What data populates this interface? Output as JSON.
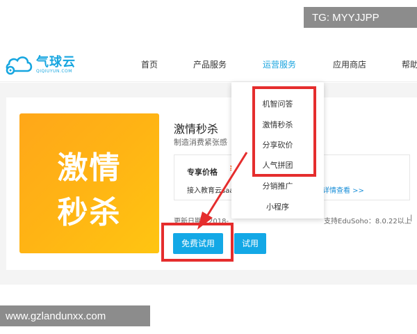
{
  "watermarks": {
    "top": "TG: MYYJJPP",
    "bottom": "www.gzlandunxx.com"
  },
  "brand": {
    "name": "气球云",
    "sub": "QIQIUYUN.COM",
    "color": "#17a6e0"
  },
  "nav": {
    "items": [
      {
        "label": "首页"
      },
      {
        "label": "产品服务"
      },
      {
        "label": "运营服务"
      },
      {
        "label": "应用商店"
      },
      {
        "label": "帮助"
      }
    ],
    "active": "运营服务"
  },
  "dropdown": {
    "items": [
      {
        "label": "机智问答"
      },
      {
        "label": "激情秒杀"
      },
      {
        "label": "分享砍价"
      },
      {
        "label": "人气拼团"
      },
      {
        "label": "分销推广"
      },
      {
        "label": "小程序"
      }
    ]
  },
  "product": {
    "image_line1": "激情",
    "image_line2": "秒杀",
    "title": "激情秒杀",
    "subtitle": "制造消费紧张感",
    "price_label": "专享价格",
    "price_value": "¥",
    "price_desc": "接入教育云saas",
    "price_link": "详情查看 >>",
    "update_date": "更新日期：2018-",
    "support": "支持EduSoho：8.0.22以上",
    "separator": "|"
  },
  "buttons": {
    "free_trial": "免费试用",
    "trial": "试用"
  },
  "colors": {
    "accent": "#13a8e6",
    "highlight": "#e52d2d",
    "price": "#ff4a00",
    "product_bg": "#ffb414"
  }
}
